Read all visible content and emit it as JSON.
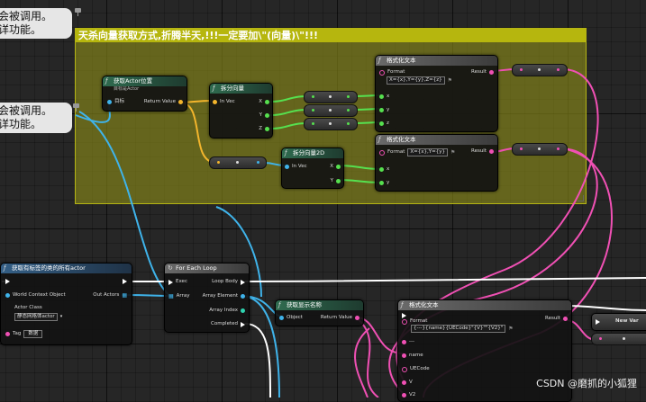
{
  "comments": {
    "bubble_top": [
      "会被调用。",
      "详功能。"
    ],
    "bubble_mid": [
      "会被调用。",
      "详功能。"
    ],
    "group_title": "天杀向量获取方式,折腾半天,!!!一定要加\\\"(向量)\\\"!!!"
  },
  "nodes": {
    "get_actor_location": {
      "title": "获取Actor位置",
      "subtitle": "目标是Actor",
      "pin_target": "目标",
      "pin_return": "Return Value"
    },
    "break_vector": {
      "title": "拆分向量",
      "pin_in": "In Vec",
      "pin_x": "X",
      "pin_y": "Y",
      "pin_z": "Z"
    },
    "break_vector2d": {
      "title": "拆分向量2D",
      "pin_in": "In Vec",
      "pin_x": "X",
      "pin_y": "Y"
    },
    "format_text_1": {
      "title": "格式化文本",
      "format_label": "Format",
      "format_value": "X={x},Y={y},Z={z}",
      "pin_result": "Result",
      "pin_x": "x",
      "pin_y": "y",
      "pin_z": "z"
    },
    "format_text_2": {
      "title": "格式化文本",
      "format_label": "Format",
      "format_value": "X={x},Y={y}",
      "pin_result": "Result",
      "pin_x": "x",
      "pin_y": "y"
    },
    "get_all_actors": {
      "title": "获取有标签的类的所有actor",
      "pin_world": "World Context Object",
      "pin_out": "Out Actors",
      "pin_class": "Actor Class",
      "class_value": "静态网格体actor",
      "pin_tag": "Tag",
      "tag_value": "数据"
    },
    "for_each_loop": {
      "title": "For Each Loop",
      "pin_exec": "Exec",
      "pin_loop_body": "Loop Body",
      "pin_array": "Array",
      "pin_array_element": "Array Element",
      "pin_array_index": "Array Index",
      "pin_completed": "Completed"
    },
    "get_display_name": {
      "title": "获取显示名称",
      "pin_object": "Object",
      "pin_return": "Return Value"
    },
    "format_text_3": {
      "title": "格式化文本",
      "format_label": "Format",
      "format_value": "{---}{name}{UECode}\"{V}\"\"{V2}\"",
      "pin_result": "Result",
      "pin_dash": "---",
      "pin_name": "name",
      "pin_uecode": "UECode",
      "pin_v": "V",
      "pin_v2": "V2"
    },
    "new_var": {
      "title": "New Var"
    }
  },
  "watermark": "CSDN @磨抓的小狐狸",
  "colors": {
    "exec": "#ffffff",
    "object": "#3fb3ea",
    "struct": "#f3b52c",
    "float": "#56e04f",
    "text": "#f050b4",
    "comment": "#b6b60e"
  }
}
